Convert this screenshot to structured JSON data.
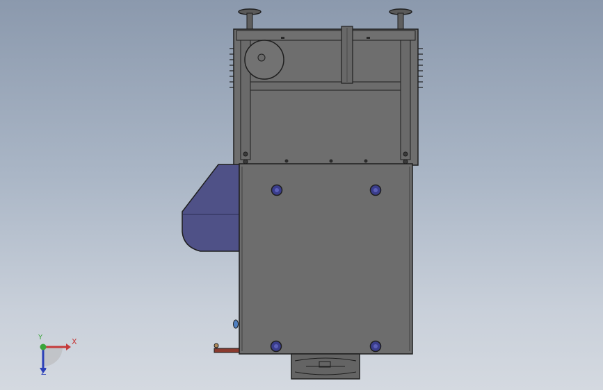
{
  "viewport": {
    "background_top": "#8b99ad",
    "background_bottom": "#d4d9e0"
  },
  "model": {
    "body_color": "#6d6d6d",
    "frame_color": "#6e6e6e",
    "edge_color": "#1e1e1e",
    "motor_color": "#4f5187",
    "fastener_color": "#3a3d8c",
    "handle_color": "#8a3a2e"
  },
  "triad": {
    "x_label": "X",
    "y_label": "Y",
    "z_label": "Z",
    "x_color": "#c53a3a",
    "y_color": "#3aa53a",
    "z_color": "#2b3fb8"
  }
}
